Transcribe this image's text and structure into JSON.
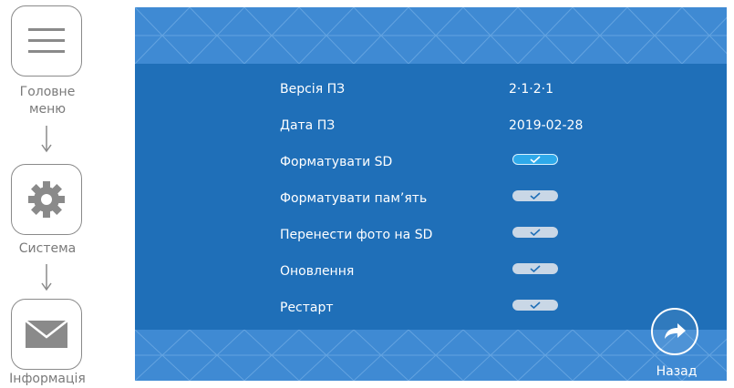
{
  "guide": {
    "steps": [
      {
        "icon": "menu-icon",
        "label_line1": "Головне",
        "label_line2": "меню"
      },
      {
        "icon": "gear-icon",
        "label": "Система"
      },
      {
        "icon": "envelope-icon",
        "label": "Інформація"
      }
    ]
  },
  "screen": {
    "rows": [
      {
        "label": "Версія ПЗ",
        "value": "2·1·2·1"
      },
      {
        "label": "Дата ПЗ",
        "value": "2019-02-28"
      },
      {
        "label": "Форматувати SD",
        "toggle": true,
        "active": true
      },
      {
        "label": "Форматувати пам’ять",
        "toggle": true,
        "active": false
      },
      {
        "label": "Перенести фото на SD",
        "toggle": true,
        "active": false
      },
      {
        "label": "Оновлення",
        "toggle": true,
        "active": false
      },
      {
        "label": "Рестарт",
        "toggle": true,
        "active": false
      }
    ],
    "back_label": "Назад"
  },
  "colors": {
    "screen_bg": "#1f6fb8",
    "band_bg": "#3f8ad3",
    "toggle_inactive": "#c9d7e6",
    "toggle_active": "#2ea9ea",
    "guide_text": "#7a7a7a"
  }
}
